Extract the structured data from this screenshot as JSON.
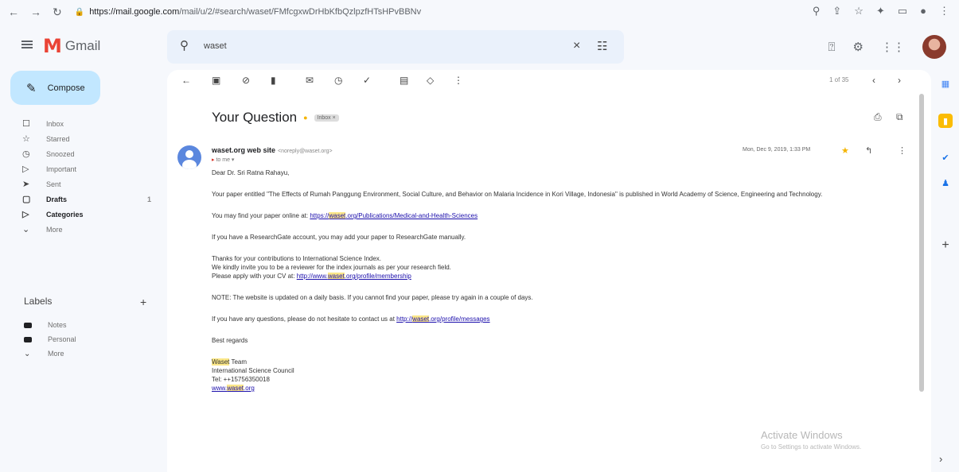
{
  "browser": {
    "url_host": "https://mail.google.com",
    "url_path": "/mail/u/2/#search/waset/FMfcgxwDrHbKfbQzlpzfHTsHPvBBNv",
    "back_icon": "back-arrow-icon",
    "forward_icon": "forward-arrow-icon",
    "reload_icon": "reload-icon"
  },
  "app": {
    "name": "Gmail",
    "logo_letter": "M",
    "menu_icon": "hamburger-icon"
  },
  "search": {
    "query": "waset",
    "clear_icon": "×",
    "options_icon": "⚙"
  },
  "compose_label": "Compose",
  "sidebar": {
    "items": [
      {
        "label": "Inbox",
        "icon": "☐",
        "bold": false
      },
      {
        "label": "Starred",
        "icon": "☆",
        "bold": false
      },
      {
        "label": "Snoozed",
        "icon": "◷",
        "bold": false
      },
      {
        "label": "Important",
        "icon": "▷",
        "bold": false
      },
      {
        "label": "Sent",
        "icon": "➤",
        "bold": false
      },
      {
        "label": "Drafts",
        "icon": "▢",
        "bold": true,
        "count": "1"
      },
      {
        "label": "Categories",
        "icon": "▷",
        "bold": true
      },
      {
        "label": "More",
        "icon": "⌄",
        "bold": false
      }
    ]
  },
  "labels": {
    "heading": "Labels",
    "add_icon": "+",
    "items": [
      {
        "label": "Notes"
      },
      {
        "label": "Personal"
      },
      {
        "label": "More"
      }
    ]
  },
  "toolbar": {
    "pager": "1 of 35"
  },
  "email": {
    "subject": "Your Question",
    "tag": "Inbox ×",
    "sender_name": "waset.org web site",
    "sender_email": "<noreply@waset.org>",
    "to_line": "to me",
    "date": "Mon, Dec 9, 2019, 1:33 PM",
    "greeting": "Dear Dr. Sri Ratna Rahayu,",
    "para1": "Your paper entitled \"The Effects of Rumah Panggung Environment, Social Culture, and Behavior on Malaria Incidence in Kori Village, Indonesia\" is published in World Academy of Science, Engineering and Technology.",
    "para2_text": "You may find your paper online at: ",
    "para2_link_a": "https://",
    "para2_link_hl": "waset",
    "para2_link_b": ".org/Publications/Medical-and-Health-Sciences",
    "para3": "If you have a ResearchGate account, you may add your paper to ResearchGate manually.",
    "para4_l1": "Thanks for your contributions to International Science Index.",
    "para4_l2": "We kindly invite you to be a reviewer for the index journals as per your research field.",
    "para4_l3_text": "Please apply with your CV at: ",
    "para4_link_a": "http://www.",
    "para4_link_hl": "waset",
    "para4_link_b": ".org/profile/membership",
    "para5": "NOTE: The website is updated on a daily basis. If you cannot find your paper, please try again in a couple of days.",
    "para6_text": "If you have any questions, please do not hesitate to contact us at ",
    "para6_link_a": "http://",
    "para6_link_hl": "waset",
    "para6_link_b": ".org/profile/messages",
    "regards": "Best regards",
    "sig_hl": "Waset",
    "sig_team": " Team",
    "sig_org": "International Science Council",
    "sig_tel": "Tel: ++15756350018",
    "sig_link_a": "www.",
    "sig_link_hl": "waset",
    "sig_link_b": ".org"
  },
  "watermark": {
    "line1": "Activate Windows",
    "line2": "Go to Settings to activate Windows."
  },
  "colors": {
    "compose_bg": "#c2e7ff",
    "search_bg": "#eaf1fb",
    "highlight": "#fbe788",
    "star": "#f4b400",
    "link": "#1a0dab"
  }
}
